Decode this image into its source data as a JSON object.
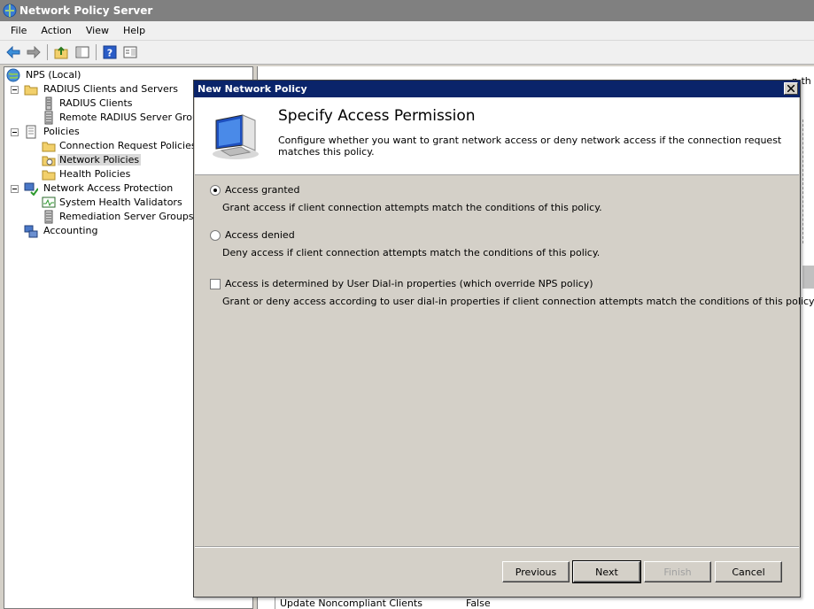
{
  "window": {
    "title": "Network Policy Server"
  },
  "menu": [
    "File",
    "Action",
    "View",
    "Help"
  ],
  "toolbar": {
    "icons": [
      "back-arrow-icon",
      "forward-arrow-icon",
      "up-folder-icon",
      "show-hide-tree-icon",
      "help-icon",
      "properties-icon"
    ]
  },
  "tree": {
    "root": "NPS (Local)",
    "radius": "RADIUS Clients and Servers",
    "radius_clients": "RADIUS Clients",
    "remote_groups": "Remote RADIUS Server Groups",
    "policies": "Policies",
    "conn_policies": "Connection Request Policies",
    "net_policies": "Network Policies",
    "health_policies": "Health Policies",
    "nap": "Network Access Protection",
    "shv": "System Health Validators",
    "remediation": "Remediation Server Groups",
    "accounting": "Accounting"
  },
  "background": {
    "row_label": "Update Noncompliant Clients",
    "row_value": "False",
    "clipped_text": "n th"
  },
  "dialog": {
    "title": "New Network Policy",
    "heading": "Specify Access Permission",
    "description": "Configure whether you want to grant network access or deny network access if the connection request matches this policy.",
    "options": {
      "granted": {
        "label": "Access granted",
        "desc": "Grant access if client connection attempts match the conditions of this policy.",
        "checked": true
      },
      "denied": {
        "label": "Access denied",
        "desc": "Deny access if client connection attempts match the conditions of this policy.",
        "checked": false
      },
      "dialin": {
        "label": "Access is determined by User Dial-in properties (which override NPS policy)",
        "desc": "Grant or deny access according to user dial-in properties if client connection attempts match the conditions of this policy.",
        "checked": false
      }
    },
    "buttons": {
      "previous": "Previous",
      "next": "Next",
      "finish": "Finish",
      "cancel": "Cancel"
    }
  },
  "colors": {
    "dialog_title_bg": "#0a246a",
    "window_title_bg": "#808080",
    "selection": "#d9d9d9"
  }
}
